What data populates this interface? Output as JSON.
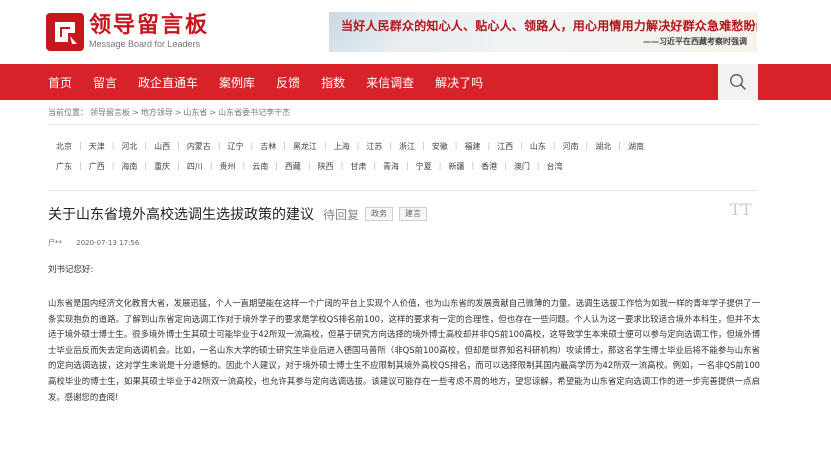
{
  "header": {
    "logo_cn": "领导留言板",
    "logo_en": "Message Board for Leaders",
    "banner_line1": "当好人民群众的知心人、贴心人、领路人，用心用情用力解决好群众急难愁盼问题。",
    "banner_line2": "——习近平在西藏考察时强调"
  },
  "nav": {
    "items": [
      "首页",
      "留言",
      "政企直通车",
      "案例库",
      "反馈",
      "指数",
      "来信调查",
      "解决了吗"
    ]
  },
  "breadcrumb": [
    "当前位置：",
    "领导留言板",
    ">",
    "地方领导",
    ">",
    "山东省",
    ">",
    "山东省委书记李干杰"
  ],
  "regions": {
    "row1": [
      "北京",
      "天津",
      "河北",
      "山西",
      "内蒙古",
      "辽宁",
      "吉林",
      "黑龙江",
      "上海",
      "江苏",
      "浙江",
      "安徽",
      "福建",
      "江西",
      "山东",
      "河南",
      "湖北",
      "湖南"
    ],
    "row2": [
      "广东",
      "广西",
      "海南",
      "重庆",
      "四川",
      "贵州",
      "云南",
      "西藏",
      "陕西",
      "甘肃",
      "青海",
      "宁夏",
      "新疆",
      "香港",
      "澳门",
      "台湾"
    ]
  },
  "message": {
    "title": "关于山东省境外高校选调生选拔政策的建议",
    "status": "待回复",
    "tags": [
      "政务",
      "建言"
    ],
    "font_toggle": "TT",
    "author": "尸**",
    "date": "2020-07-13 17:56",
    "greeting": "刘书记您好:",
    "body": "山东省是国内经济文化教育大省，发展迅猛，个人一直期望能在这样一个广阔的平台上实现个人价值，也为山东省的发展贡献自己微薄的力量。选调生选拔工作恰为如我一样的青年学子提供了一条实现抱负的道路。了解到山东省定向选调工作对于境外学子的要求是学校QS排名前100，这样的要求有一定的合理性，但也存在一些问题。个人认为这一要求比较适合境外本科生，但并不太适于境外硕士博士生。很多境外博士生其硕士可能毕业于42所双一流高校，但基于研究方向选择的境外博士高校却并非QS前100高校，这导致学生本来硕士便可以参与定向选调工作，但境外博士毕业后反而失去定向选调机会。比如，一名山东大学的硕士研究生毕业后进入德国马普所（非QS前100高校，但却是世界知名科研机构）攻读博士，那这名学生博士毕业后将不能参与山东省的定向选调选拔，这对学生来说是十分遗憾的。因此个人建议，对于境外硕士博士生不应限制其境外高校QS排名，而可以选择限制其国内最高学历为42所双一流高校。例如，一名非QS前100高校毕业的博士生，如果其硕士毕业于42所双一流高校，也允许其参与定向选调选拔。该建议可能存在一些考虑不周的地方，望您谅解，希望能为山东省定向选调工作的进一步完善提供一点启发。感谢您的查阅!"
  },
  "colors": {
    "brand_red": "#d8222a",
    "logo_red": "#c8161d"
  }
}
